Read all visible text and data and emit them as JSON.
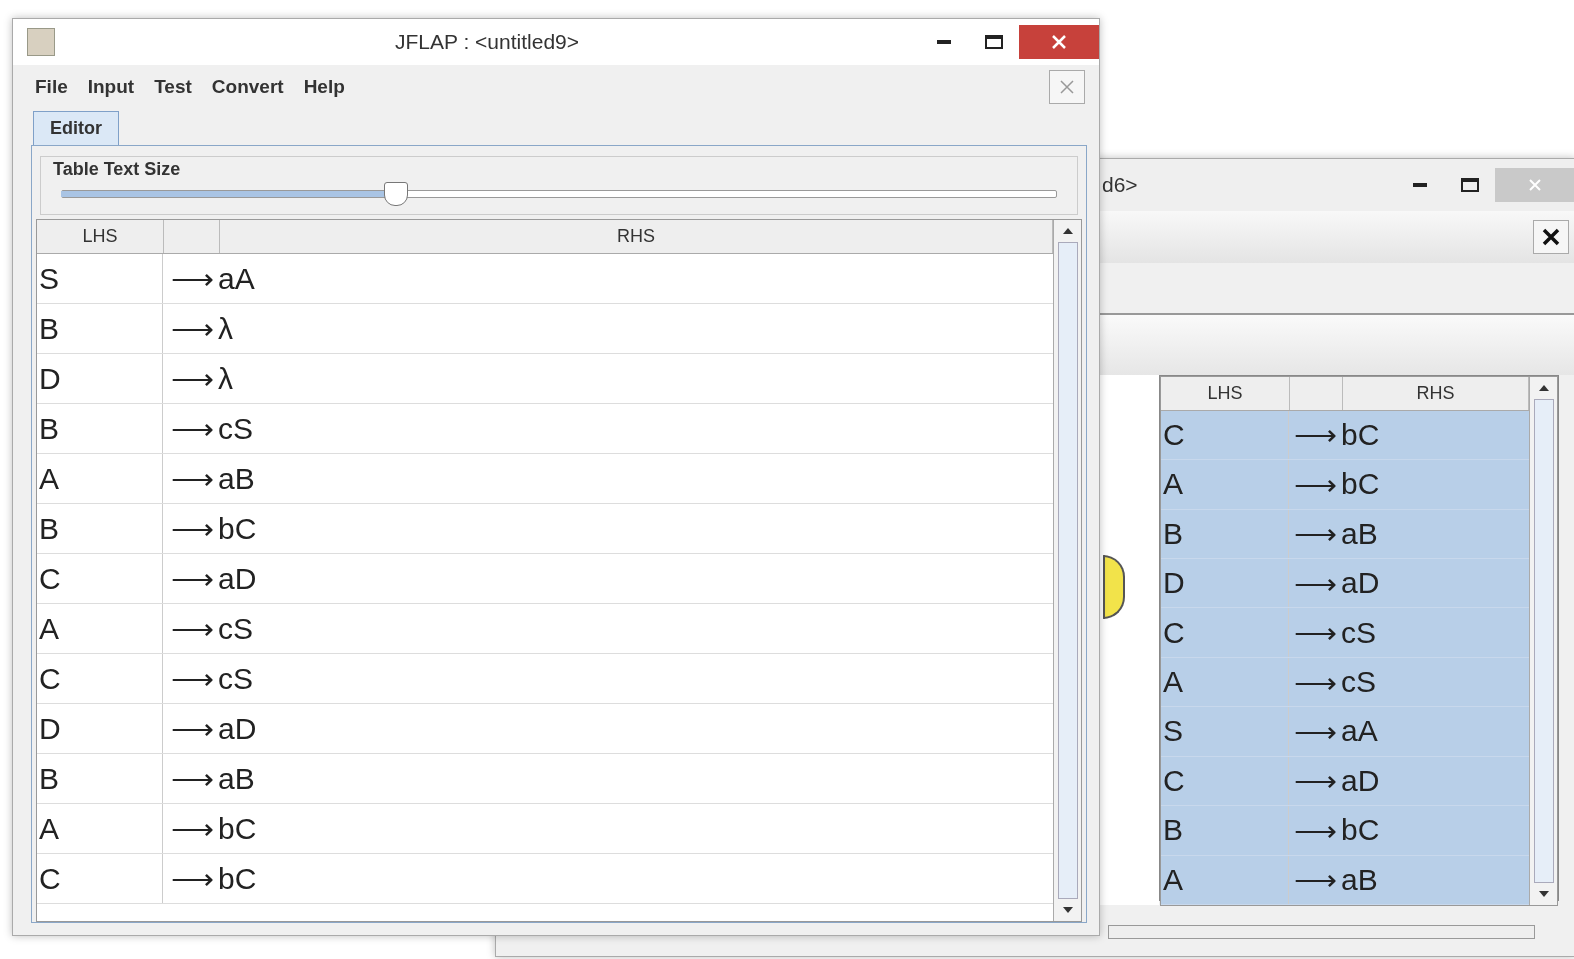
{
  "front_window": {
    "title": "JFLAP : <untitled9>",
    "menu": [
      "File",
      "Input",
      "Test",
      "Convert",
      "Help"
    ],
    "tabs": [
      {
        "label": "Editor",
        "selected": true
      }
    ],
    "slider": {
      "label": "Table Text Size",
      "level": 0.335
    },
    "table": {
      "columns": [
        "LHS",
        "RHS"
      ],
      "rows": [
        {
          "lhs": "S",
          "arrow": "⟶",
          "rhs": "aA",
          "selected": false
        },
        {
          "lhs": "B",
          "arrow": "⟶",
          "rhs": "λ",
          "selected": false
        },
        {
          "lhs": "D",
          "arrow": "⟶",
          "rhs": "λ",
          "selected": false
        },
        {
          "lhs": "B",
          "arrow": "⟶",
          "rhs": "cS",
          "selected": false
        },
        {
          "lhs": "A",
          "arrow": "⟶",
          "rhs": "aB",
          "selected": false
        },
        {
          "lhs": "B",
          "arrow": "⟶",
          "rhs": "bC",
          "selected": false
        },
        {
          "lhs": "C",
          "arrow": "⟶",
          "rhs": "aD",
          "selected": false
        },
        {
          "lhs": "A",
          "arrow": "⟶",
          "rhs": "cS",
          "selected": false
        },
        {
          "lhs": "C",
          "arrow": "⟶",
          "rhs": "cS",
          "selected": false
        },
        {
          "lhs": "D",
          "arrow": "⟶",
          "rhs": "aD",
          "selected": false
        },
        {
          "lhs": "B",
          "arrow": "⟶",
          "rhs": "aB",
          "selected": false
        },
        {
          "lhs": "A",
          "arrow": "⟶",
          "rhs": "bC",
          "selected": false
        },
        {
          "lhs": "C",
          "arrow": "⟶",
          "rhs": "bC",
          "selected": false
        }
      ]
    }
  },
  "back_window": {
    "title": "d6>",
    "table": {
      "columns": [
        "LHS",
        "RHS"
      ],
      "rows": [
        {
          "lhs": "C",
          "arrow": "⟶",
          "rhs": "bC",
          "selected": true
        },
        {
          "lhs": "A",
          "arrow": "⟶",
          "rhs": "bC",
          "selected": true
        },
        {
          "lhs": "B",
          "arrow": "⟶",
          "rhs": "aB",
          "selected": true
        },
        {
          "lhs": "D",
          "arrow": "⟶",
          "rhs": "aD",
          "selected": true
        },
        {
          "lhs": "C",
          "arrow": "⟶",
          "rhs": "cS",
          "selected": true
        },
        {
          "lhs": "A",
          "arrow": "⟶",
          "rhs": "cS",
          "selected": true
        },
        {
          "lhs": "S",
          "arrow": "⟶",
          "rhs": "aA",
          "selected": true
        },
        {
          "lhs": "C",
          "arrow": "⟶",
          "rhs": "aD",
          "selected": true
        },
        {
          "lhs": "B",
          "arrow": "⟶",
          "rhs": "bC",
          "selected": true
        },
        {
          "lhs": "A",
          "arrow": "⟶",
          "rhs": "aB",
          "selected": true
        }
      ]
    }
  }
}
